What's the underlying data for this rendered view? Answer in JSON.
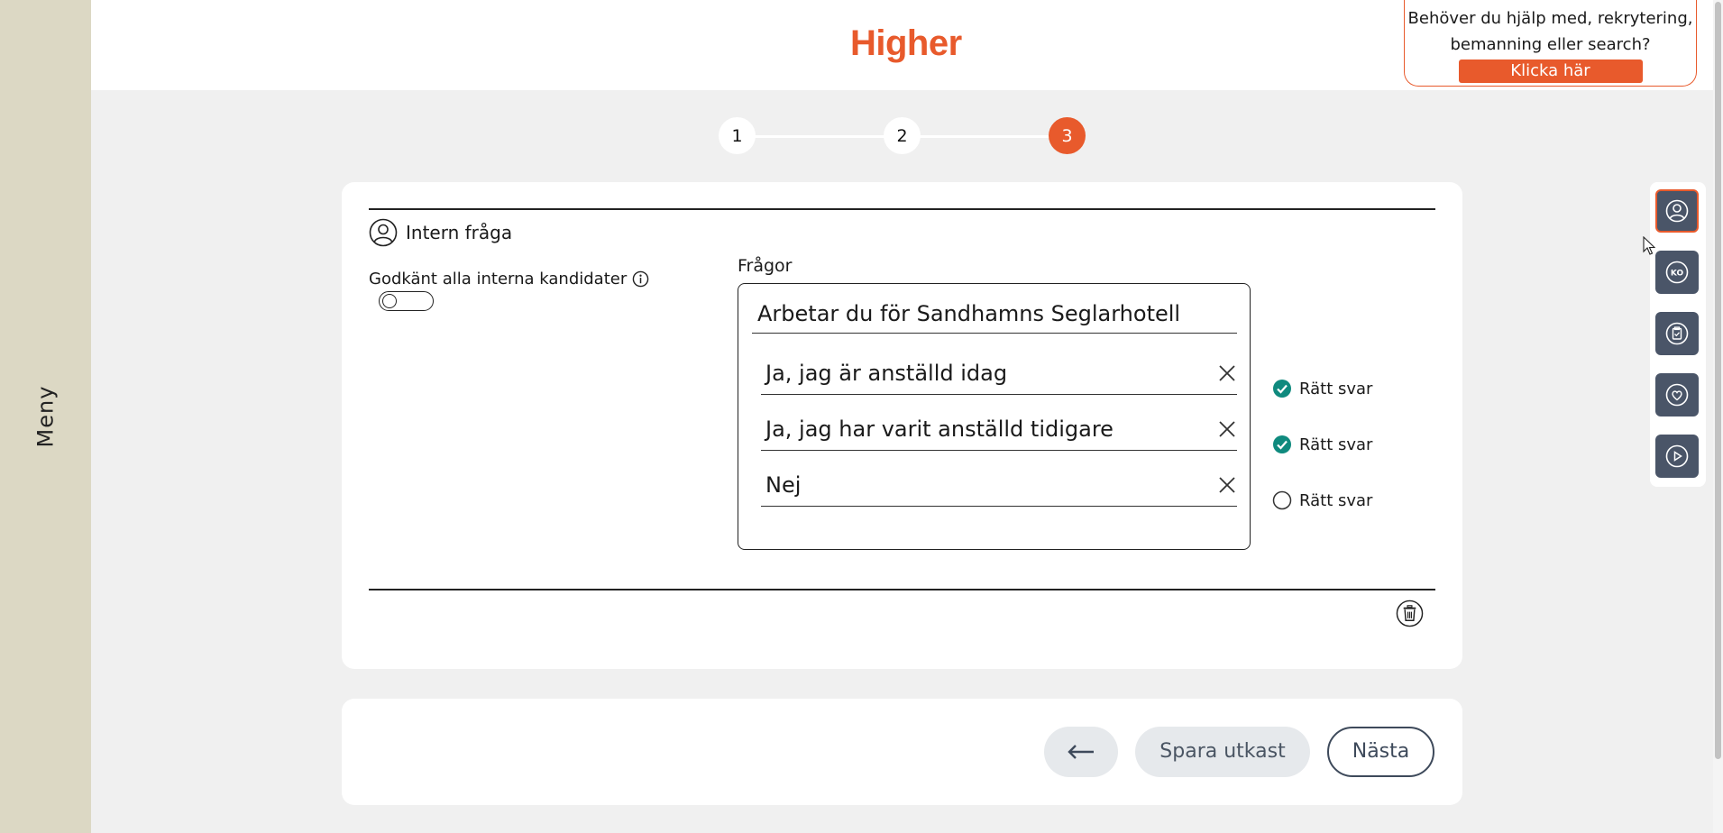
{
  "menu": {
    "label": "Meny"
  },
  "header": {
    "logo": "Higher",
    "help_line1": "Behöver du hjälp med, rekrytering,",
    "help_line2": "bemanning eller search?",
    "help_cta": "Klicka här"
  },
  "stepper": {
    "steps": [
      "1",
      "2",
      "3"
    ],
    "active": 3
  },
  "section": {
    "title": "Intern fråga",
    "approve_label": "Godkänt alla interna kandidater",
    "questions_label": "Frågor",
    "question": "Arbetar du för Sandhamns Seglarhotell",
    "answers": [
      {
        "text": "Ja, jag är anställd idag",
        "correct_label": "Rätt svar",
        "correct": true
      },
      {
        "text": "Ja, jag har varit anställd tidigare",
        "correct_label": "Rätt svar",
        "correct": true
      },
      {
        "text": "Nej",
        "correct_label": "Rätt svar",
        "correct": false
      }
    ]
  },
  "footer": {
    "draft_label": "Spara utkast",
    "next_label": "Nästa"
  },
  "colors": {
    "brand": "#e85a2c",
    "check": "#0f8a7e",
    "tool": "#4a5568"
  },
  "tool_icons": [
    "user-circle-icon",
    "ko-icon",
    "clipboard-icon",
    "heart-icon",
    "play-icon"
  ]
}
